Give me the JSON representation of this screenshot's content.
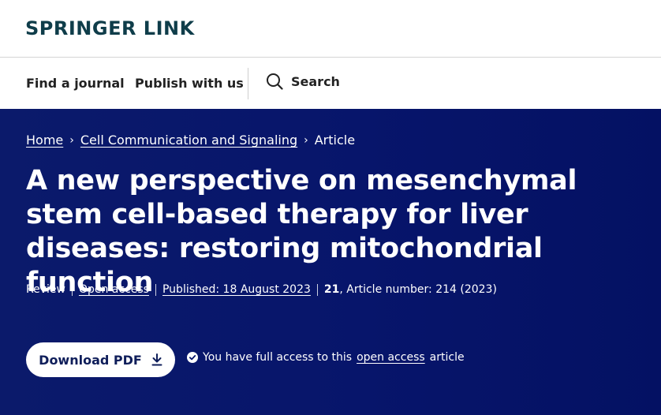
{
  "header": {
    "logo_text": "SPRINGER LINK",
    "nav": {
      "find_journal": "Find a journal",
      "publish": "Publish with us",
      "search": "Search"
    }
  },
  "breadcrumb": {
    "home": "Home",
    "journal": "Cell Communication and Signaling",
    "current": "Article"
  },
  "article": {
    "title": "A new perspective on mesenchymal stem cell-based therapy for liver diseases: restoring mitochondrial function",
    "type": "Review",
    "open_access": "Open access",
    "published": "Published: 18 August 2023",
    "volume": "21",
    "article_number": ", Article number: 214 (2023)"
  },
  "actions": {
    "download_label": "Download PDF",
    "access_prefix": "You have full access to this",
    "access_link": "open access",
    "access_suffix": "article"
  },
  "colors": {
    "brand": "#0f3d4a",
    "hero_bg": "#07156b",
    "button_text": "#0f1e5a"
  }
}
